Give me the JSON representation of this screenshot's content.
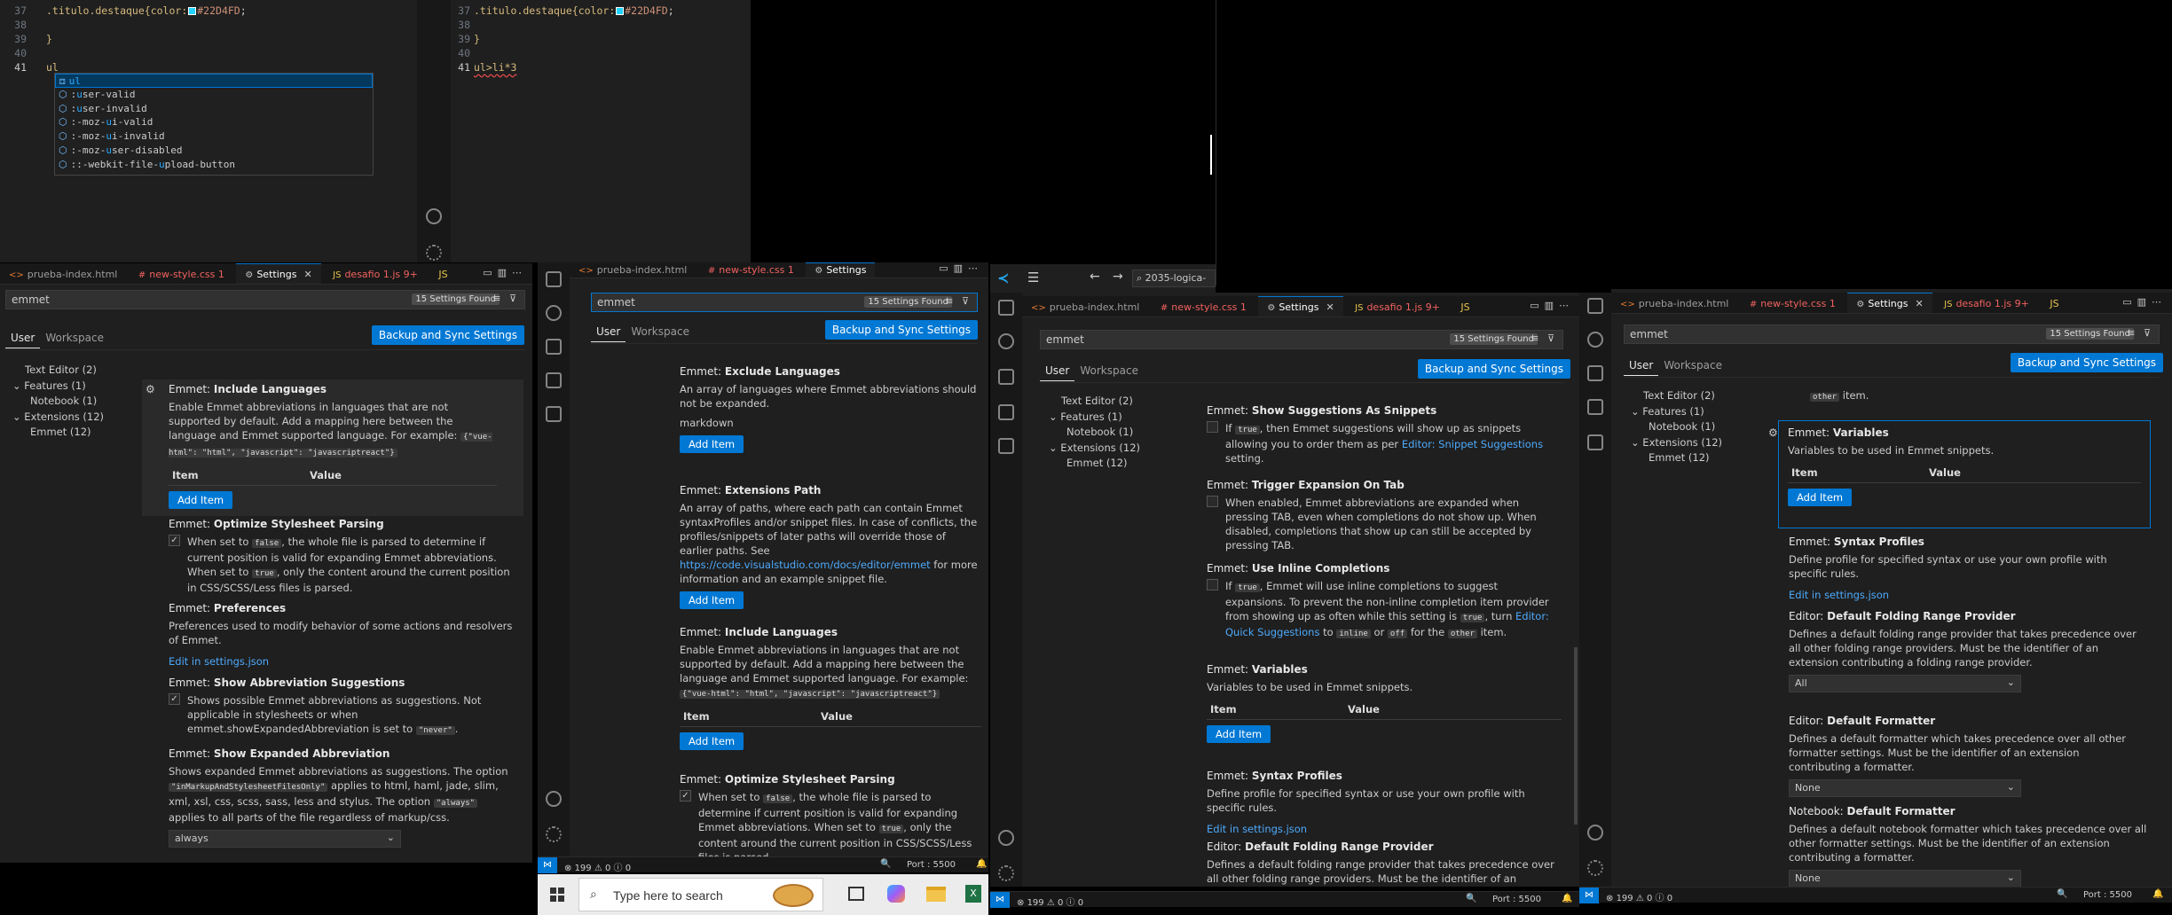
{
  "colors": {
    "accent": "#0078d4",
    "link": "#4daafc",
    "swatch": "#22D4FD"
  },
  "tabs": {
    "w1": [
      {
        "label": "prueba-index.html",
        "kind": "html"
      },
      {
        "label": "new-style.css 1",
        "kind": "css"
      },
      {
        "label": "Settings",
        "kind": "gear",
        "active": true
      },
      {
        "label": "desafio 1.js 9+",
        "kind": "js"
      },
      {
        "label": "JS",
        "kind": "js"
      }
    ],
    "w2": [
      {
        "label": "prueba-index.html",
        "kind": "html"
      },
      {
        "label": "new-style.css 1",
        "kind": "css"
      },
      {
        "label": "Settings",
        "kind": "gear",
        "active": true
      }
    ],
    "w3": [
      {
        "label": "prueba-index.html",
        "kind": "html"
      },
      {
        "label": "new-style.css 1",
        "kind": "css"
      },
      {
        "label": "Settings",
        "kind": "gear",
        "active": true
      },
      {
        "label": "desafio 1.js 9+",
        "kind": "js"
      },
      {
        "label": "JS",
        "kind": "js"
      }
    ],
    "w4": [
      {
        "label": "prueba-index.html",
        "kind": "html"
      },
      {
        "label": "new-style.css 1",
        "kind": "css"
      },
      {
        "label": "Settings",
        "kind": "gear",
        "active": true
      },
      {
        "label": "desafio 1.js 9+",
        "kind": "js"
      },
      {
        "label": "JS",
        "kind": "js"
      }
    ]
  },
  "editor_left": {
    "line_numbers": [
      "37",
      "38",
      "39",
      "40",
      "41"
    ],
    "line37": ".titulo.destaque{color:",
    "line37_color": "#22D4FD",
    "line37_end": ";",
    "line39": "}",
    "line41": "ul",
    "suggestions": [
      {
        "pre": "",
        "match": "ul",
        "post": ""
      },
      {
        "pre": ":",
        "match": "u",
        "post": "ser-valid"
      },
      {
        "pre": ":",
        "match": "u",
        "post": "ser-invalid"
      },
      {
        "pre": ":-moz-",
        "match": "u",
        "post": "i-valid"
      },
      {
        "pre": ":-moz-",
        "match": "u",
        "post": "i-invalid"
      },
      {
        "pre": ":-moz-",
        "match": "u",
        "post": "ser-disabled"
      },
      {
        "pre": "::-webkit-file-",
        "match": "u",
        "post": "pload-button"
      }
    ]
  },
  "editor_right": {
    "line_numbers": [
      "37",
      "38",
      "39",
      "40",
      "41"
    ],
    "line37": ".titulo.destaque{color:",
    "line37_color": "#22D4FD",
    "line37_end": ";",
    "line39": "}",
    "line41": "ul>li*3"
  },
  "settings": {
    "search_value": "emmet",
    "found": "15 Settings Found",
    "scope_user": "User",
    "scope_workspace": "Workspace",
    "sync_button": "Backup and Sync Settings",
    "add_item": "Add Item",
    "col_item": "Item",
    "col_value": "Value",
    "edit_json": "Edit in settings.json",
    "toc": {
      "text_editor": "Text Editor (2)",
      "features": "Features (1)",
      "notebook": "Notebook (1)",
      "extensions": "Extensions (12)",
      "emmet": "Emmet (12)"
    },
    "cat_emmet": "Emmet: ",
    "cat_editor": "Editor: ",
    "cat_notebook": "Notebook: ",
    "include_languages": {
      "title": "Include Languages",
      "desc_a": "Enable Emmet abbreviations in languages that are not supported by default. Add a mapping here between the language and Emmet supported language. For example: ",
      "code": "{\"vue-html\": \"html\", \"javascript\": \"javascriptreact\"}"
    },
    "optimize": {
      "title": "Optimize Stylesheet Parsing",
      "pre": "When set to ",
      "false": "false",
      "mid": ", the whole file is parsed to determine if current position is valid for expanding Emmet abbreviations. When set to ",
      "true": "true",
      "post": ", only the content around the current position in CSS/SCSS/Less files is parsed."
    },
    "preferences": {
      "title": "Preferences",
      "desc": "Preferences used to modify behavior of some actions and resolvers of Emmet."
    },
    "show_abbrev": {
      "title": "Show Abbreviation Suggestions",
      "desc_a": "Shows possible Emmet abbreviations as suggestions. Not applicable in stylesheets or when emmet.showExpandedAbbreviation is set to ",
      "token": "\"never\"",
      "desc_b": "."
    },
    "show_expanded": {
      "title": "Show Expanded Abbreviation",
      "desc_a": "Shows expanded Emmet abbreviations as suggestions. The option ",
      "token1": "\"inMarkupAndStylesheetFilesOnly\"",
      "desc_b": " applies to html, haml, jade, slim, xml, xsl, css, scss, sass, less and stylus. The option ",
      "token2": "\"always\"",
      "desc_c": " applies to all parts of the file regardless of markup/css.",
      "value": "always"
    },
    "exclude_languages": {
      "title": "Exclude Languages",
      "desc": "An array of languages where Emmet abbreviations should not be expanded.",
      "item": "markdown"
    },
    "extensions_path": {
      "title": "Extensions Path",
      "desc_a": "An array of paths, where each path can contain Emmet syntaxProfiles and/or snippet files. In case of conflicts, the profiles/snippets of later paths will override those of earlier paths. See ",
      "link": "https://code.visualstudio.com/docs/editor/emmet",
      "desc_b": " for more information and an example snippet file."
    },
    "show_snippets": {
      "title": "Show Suggestions As Snippets",
      "pre": "If ",
      "true": "true",
      "mid": ", then Emmet suggestions will show up as snippets allowing you to order them as per ",
      "link": "Editor: Snippet Suggestions",
      "post": " setting."
    },
    "trigger_tab": {
      "title": "Trigger Expansion On Tab",
      "desc": "When enabled, Emmet abbreviations are expanded when pressing TAB, even when completions do not show up. When disabled, completions that show up can still be accepted by pressing TAB."
    },
    "inline": {
      "title": "Use Inline Completions",
      "pre": "If ",
      "true": "true",
      "mid": ", Emmet will use inline completions to suggest expansions. To prevent the non-inline completion item provider from showing up as often while this setting is ",
      "true2": "true",
      "mid2": ", turn ",
      "link": "Editor: Quick Suggestions",
      "to": " to ",
      "inline": "inline",
      "or": " or ",
      "off": "off",
      "for": " for the ",
      "other": "other",
      "end": " item."
    },
    "variables": {
      "title": "Variables",
      "desc": "Variables to be used in Emmet snippets."
    },
    "syntax_profiles": {
      "title": "Syntax Profiles",
      "desc": "Define profile for specified syntax or use your own profile with specific rules."
    },
    "folding": {
      "title": "Default Folding Range Provider",
      "desc": "Defines a default folding range provider that takes precedence over all other folding range providers. Must be the identifier of an extension contributing a folding range provider.",
      "value": "All"
    },
    "formatter": {
      "title": "Default Formatter",
      "desc": "Defines a default formatter which takes precedence over all other formatter settings. Must be the identifier of an extension contributing a formatter.",
      "value": "None"
    },
    "nb_formatter": {
      "title": "Default Formatter",
      "desc": "Defines a default notebook formatter which takes precedence over all other formatter settings. Must be the identifier of an extension contributing a formatter.",
      "value": "None"
    },
    "other_item": "item."
  },
  "titlebar": {
    "search": "2035-logica-"
  },
  "status": {
    "errors": "199",
    "warnings": "0",
    "info": "0",
    "port": "Port : 5500"
  },
  "taskbar": {
    "search_placeholder": "Type here to search"
  }
}
